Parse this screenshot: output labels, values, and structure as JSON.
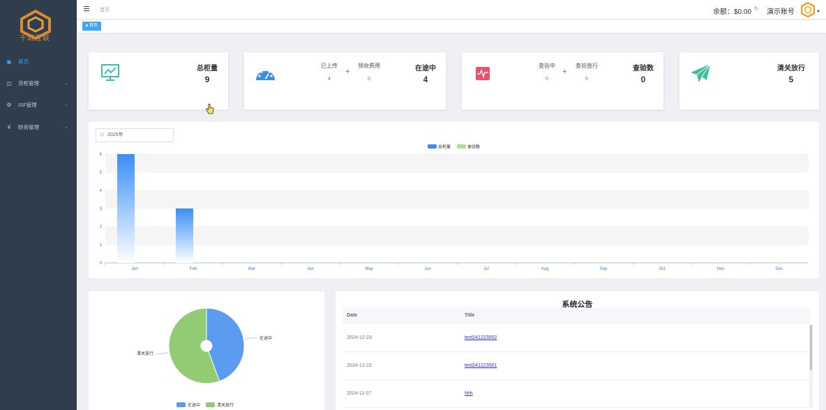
{
  "sidebar": {
    "logo_text": "千城互联",
    "items": [
      {
        "label": "首页",
        "icon": "home-icon"
      },
      {
        "label": "货柜管理",
        "icon": "container-icon"
      },
      {
        "label": "ISF管理",
        "icon": "gear-icon"
      },
      {
        "label": "财务管理",
        "icon": "yen-icon"
      }
    ]
  },
  "header": {
    "breadcrumb": "首页",
    "balance": "余额：$0.00",
    "account": "演示账号"
  },
  "tags": [
    {
      "label": "首页"
    }
  ],
  "stats": {
    "total": {
      "title": "总柜量",
      "value": "9"
    },
    "transit": {
      "title": "在途中",
      "value": "4",
      "sub1_label": "已上传",
      "sub1_value": "4",
      "sub2_label": "预收费用",
      "sub2_value": "0"
    },
    "inspect": {
      "title": "查验数",
      "value": "0",
      "sub1_label": "查验中",
      "sub1_value": "0",
      "sub2_label": "查验放行",
      "sub2_value": "0"
    },
    "cleared": {
      "title": "清关放行",
      "value": "5"
    }
  },
  "year_picker": {
    "value": "2025年"
  },
  "chart_data": [
    {
      "type": "bar",
      "categories": [
        "Jan",
        "Feb",
        "Mar",
        "Apr",
        "May",
        "Jun",
        "Jul",
        "Aug",
        "Sep",
        "Oct",
        "Nov",
        "Dec"
      ],
      "series": [
        {
          "name": "总柜量",
          "values": [
            6,
            3,
            0,
            0,
            0,
            0,
            0,
            0,
            0,
            0,
            0,
            0
          ],
          "color": "#3a8ef6"
        },
        {
          "name": "查验数",
          "values": [
            0,
            0,
            0,
            0,
            0,
            0,
            0,
            0,
            0,
            0,
            0,
            0
          ],
          "color": "#a8e38e"
        }
      ],
      "yticks": [
        "0",
        "1",
        "2",
        "3",
        "4",
        "5",
        "6"
      ],
      "ylim": [
        0,
        6
      ],
      "legend": "top-center"
    },
    {
      "type": "pie",
      "slices": [
        {
          "name": "在途中",
          "value": 4,
          "color": "#5b9bf0"
        },
        {
          "name": "清关放行",
          "value": 5,
          "color": "#91cc75"
        }
      ],
      "legend": "bottom-center"
    }
  ],
  "notice": {
    "title": "系统公告",
    "columns": [
      "Date",
      "Title"
    ],
    "rows": [
      {
        "date": "2024-12-23",
        "title": "test241223002"
      },
      {
        "date": "2024-12-23",
        "title": "test241223001"
      },
      {
        "date": "2024-11-07",
        "title": "hhh"
      }
    ]
  }
}
